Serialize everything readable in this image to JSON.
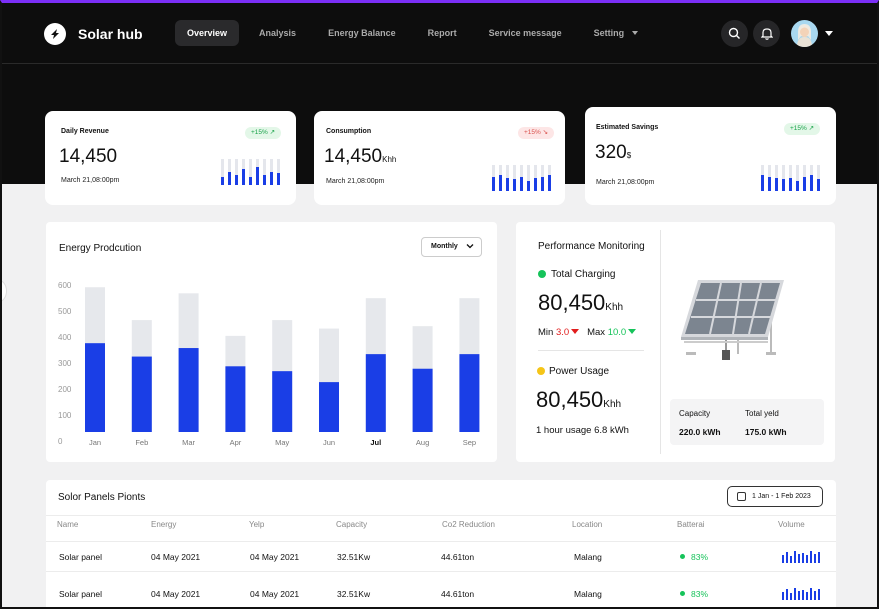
{
  "app": {
    "brand": "Solar hub"
  },
  "nav": {
    "items": [
      "Overview",
      "Analysis",
      "Energy Balance",
      "Report",
      "Service message",
      "Setting"
    ],
    "active": "Overview"
  },
  "header_icons": [
    "search-icon",
    "bell-icon",
    "avatar",
    "caret-down-icon"
  ],
  "stats": [
    {
      "title": "Daily Revenue",
      "value": "14,450",
      "unit": "",
      "badge": "+15%",
      "trend": "up",
      "date": "March 21,08:00pm"
    },
    {
      "title": "Consumption",
      "value": "14,450",
      "unit": "Khh",
      "badge": "+15%",
      "trend": "down",
      "date": "March 21,08:00pm"
    },
    {
      "title": "Estimated Savings",
      "value": "320",
      "unit": "$",
      "badge": "+15%",
      "trend": "up",
      "date": "March 21,08:00pm"
    }
  ],
  "energy": {
    "title": "Energy Prodcution",
    "dropdown": "Monthly"
  },
  "chart_data": {
    "type": "bar",
    "title": "Energy Prodcution",
    "categories": [
      "Jan",
      "Feb",
      "Mar",
      "Apr",
      "May",
      "Jun",
      "Jul",
      "Aug",
      "Sep"
    ],
    "highlight_category": "Jul",
    "yticks": [
      "600",
      "500",
      "400",
      "300",
      "200",
      "100",
      "0"
    ],
    "ylim": [
      0,
      600
    ],
    "series": [
      {
        "values": [
          365,
          310,
          345,
          270,
          250,
          205,
          320,
          260,
          320
        ]
      },
      {
        "values": [
          595,
          460,
          570,
          395,
          460,
          425,
          550,
          435,
          550
        ]
      }
    ],
    "colors": [
      "#1a3ee6",
      "#e6e8ec"
    ]
  },
  "performance": {
    "title": "Performance Monitoring",
    "charging_label": "Total Charging",
    "charging_value": "80,450",
    "charging_unit": "Khh",
    "min_label": "Min",
    "min_value": "3.0",
    "max_label": "Max",
    "max_value": "10.0",
    "usage_label": "Power Usage",
    "usage_value": "80,450",
    "usage_unit": "Khh",
    "usage_note": "1 hour usage 6.8 kWh",
    "capacity_label": "Capacity",
    "capacity_value": "220.0 kWh",
    "yield_label": "Total yeld",
    "yield_value": "175.0 kWh"
  },
  "table": {
    "title": "Solor Panels Pionts",
    "date_range": "1 Jan - 1 Feb 2023",
    "columns": [
      "Name",
      "Energy",
      "Yelp",
      "Capacity",
      "Co2 Reduction",
      "Location",
      "Batterai",
      "Volume"
    ],
    "rows": [
      {
        "name": "Solar  panel",
        "energy": "04 May 2021",
        "yelp": "04 May 2021",
        "capacity": "32.51Kw",
        "co2": "44.61ton",
        "location": "Malang",
        "battery": "83%"
      },
      {
        "name": "Solar  panel",
        "energy": "04 May 2021",
        "yelp": "04 May 2021",
        "capacity": "32.51Kw",
        "co2": "44.61ton",
        "location": "Malang",
        "battery": "83%"
      }
    ]
  },
  "colors": {
    "accent": "#1a3ee6",
    "positive": "#16c35a",
    "negative": "#e11d1d",
    "header_bg": "#0d0d0d"
  }
}
